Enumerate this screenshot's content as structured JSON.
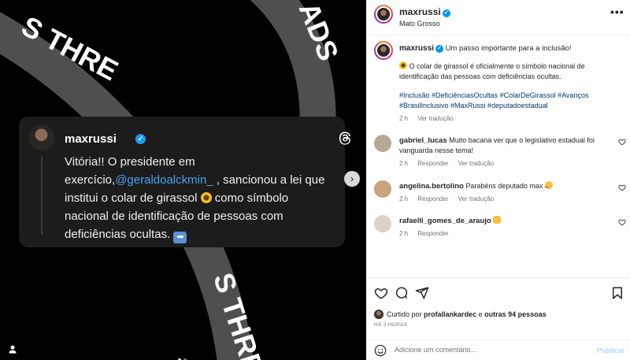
{
  "media": {
    "card": {
      "username": "maxrussi",
      "text_before_mention": "Vitória!! O presidente em exercício,",
      "mention": "@geraldoalckmin_",
      "text_after_mention": " , sancionou a lei que institui o colar de girassol",
      "text_end": " como símbolo nacional de identificação de pessoas com deficiências ocultas.",
      "arrow_emoji": "➡"
    },
    "carousel": {
      "count": 2,
      "active": 1
    }
  },
  "header": {
    "username": "maxrussi",
    "location": "Mato Grosso",
    "more": "•••"
  },
  "caption": {
    "username": "maxrussi",
    "headline": "Um passo importante para a inclusão!",
    "paragraph": "O colar de girassol é oficialmente o símbolo nacional de identificação das pessoas com deficiências ocultas.",
    "hashtags": "#Inclusão #DeficiênciasOcultas #ColarDeGirassol #Avanços #BrasilInclusivo #MaxRussi #deputadoestadual",
    "time": "2 h",
    "see_translation": "Ver tradução"
  },
  "comments": [
    {
      "username": "gabriel_lucas",
      "text": "Muito bacana ver que o legislativo estadual foi vanguarda nesse tema!",
      "time": "2 h",
      "reply": "Responder",
      "see_translation": "Ver tradução",
      "avatar_color": "#b8a894"
    },
    {
      "username": "angelina.bertolino",
      "text": "Parabéns deputado max",
      "time": "2 h",
      "reply": "Responder",
      "see_translation": "Ver tradução",
      "avatar_color": "#c9a27e"
    },
    {
      "username": "rafaelli_gomes_de_araujo",
      "text": "",
      "time": "2 h",
      "reply": "Responder",
      "see_translation": "",
      "avatar_color": "#d8d2c8"
    }
  ],
  "actions": {
    "liked_prefix": "Curtido por",
    "liked_user": "profallankardec",
    "liked_and": "e",
    "liked_others": "outras 94 pessoas",
    "time_ago": "HÁ 2 HORAS"
  },
  "add_comment": {
    "placeholder": "Adicione um comentário...",
    "post_label": "Publicar"
  }
}
